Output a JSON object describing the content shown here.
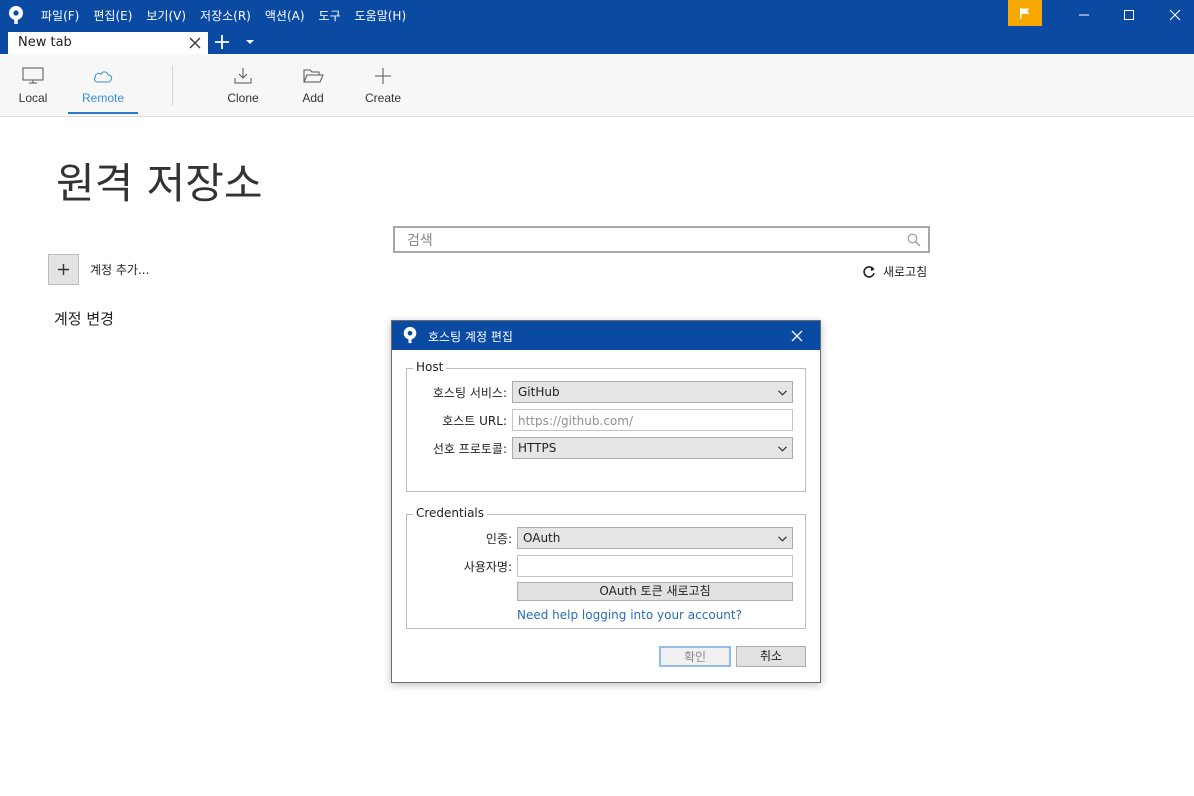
{
  "menu": [
    "파일(F)",
    "편집(E)",
    "보기(V)",
    "저장소(R)",
    "액션(A)",
    "도구",
    "도움말(H)"
  ],
  "tab": {
    "label": "New tab"
  },
  "toolbar": {
    "local": "Local",
    "remote": "Remote",
    "clone": "Clone",
    "add": "Add",
    "create": "Create"
  },
  "page": {
    "title": "원격 저장소",
    "search_placeholder": "검색",
    "refresh": "새로고침",
    "add_account": "계정 추가...",
    "change_account": "계정 변경"
  },
  "dialog": {
    "title": "호스팅 계정 편집",
    "host": {
      "legend": "Host",
      "service_label": "호스팅 서비스:",
      "service_value": "GitHub",
      "url_label": "호스트 URL:",
      "url_placeholder": "https://github.com/",
      "protocol_label": "선호 프로토콜:",
      "protocol_value": "HTTPS"
    },
    "credentials": {
      "legend": "Credentials",
      "auth_label": "인증:",
      "auth_value": "OAuth",
      "username_label": "사용자명:",
      "username_value": "",
      "oauth_refresh": "OAuth 토큰 새로고침",
      "help_link": "Need help logging into your account?"
    },
    "ok": "확인",
    "cancel": "취소"
  },
  "colors": {
    "titlebar": "#0b4aa2",
    "flag": "#f6a800",
    "link": "#2a6db5",
    "active_tab": "#3a8fd8"
  },
  "icons": [
    "sourcetree-logo-icon",
    "flag-icon",
    "minimize-icon",
    "maximize-icon",
    "close-icon",
    "plus-icon",
    "chevron-down-icon",
    "monitor-icon",
    "cloud-icon",
    "download-icon",
    "folder-open-icon",
    "search-icon",
    "refresh-icon"
  ]
}
